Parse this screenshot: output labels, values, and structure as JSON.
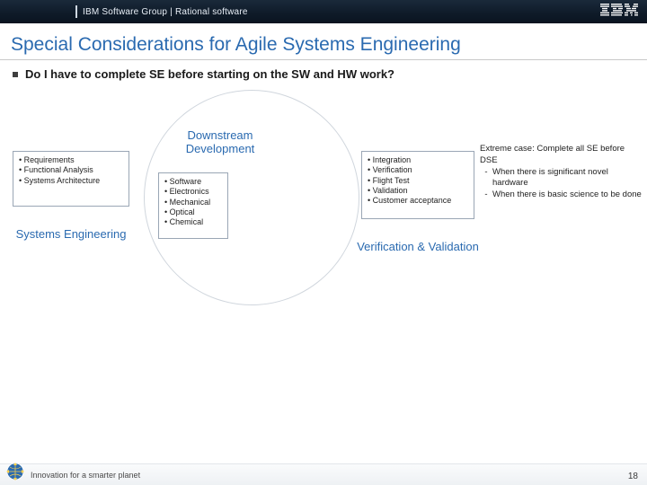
{
  "header": {
    "title": "IBM Software Group | Rational software",
    "logo_name": "ibm-logo"
  },
  "slide_title": "Special Considerations for Agile Systems Engineering",
  "question": "Do I have to complete SE before starting on the SW and HW work?",
  "blocks": {
    "systems_engineering": {
      "heading": "Systems Engineering",
      "items": [
        "Requirements",
        "Functional Analysis",
        "Systems Architecture"
      ]
    },
    "downstream": {
      "heading": "Downstream Development",
      "items": [
        "Software",
        "Electronics",
        "Mechanical",
        "Optical",
        "Chemical"
      ]
    },
    "verification": {
      "heading": "Verification & Validation",
      "items": [
        "Integration",
        "Verification",
        "Flight Test",
        "Validation",
        "Customer acceptance"
      ]
    }
  },
  "extreme": {
    "lead": "Extreme case: Complete all SE before DSE",
    "bullets": [
      "When there is significant novel hardware",
      "When there is basic science to be done"
    ]
  },
  "footer": {
    "tagline": "Innovation for a smarter planet",
    "page_number": "18"
  },
  "colors": {
    "accent": "#2a6ab0",
    "header_bg": "#0e1a28"
  }
}
